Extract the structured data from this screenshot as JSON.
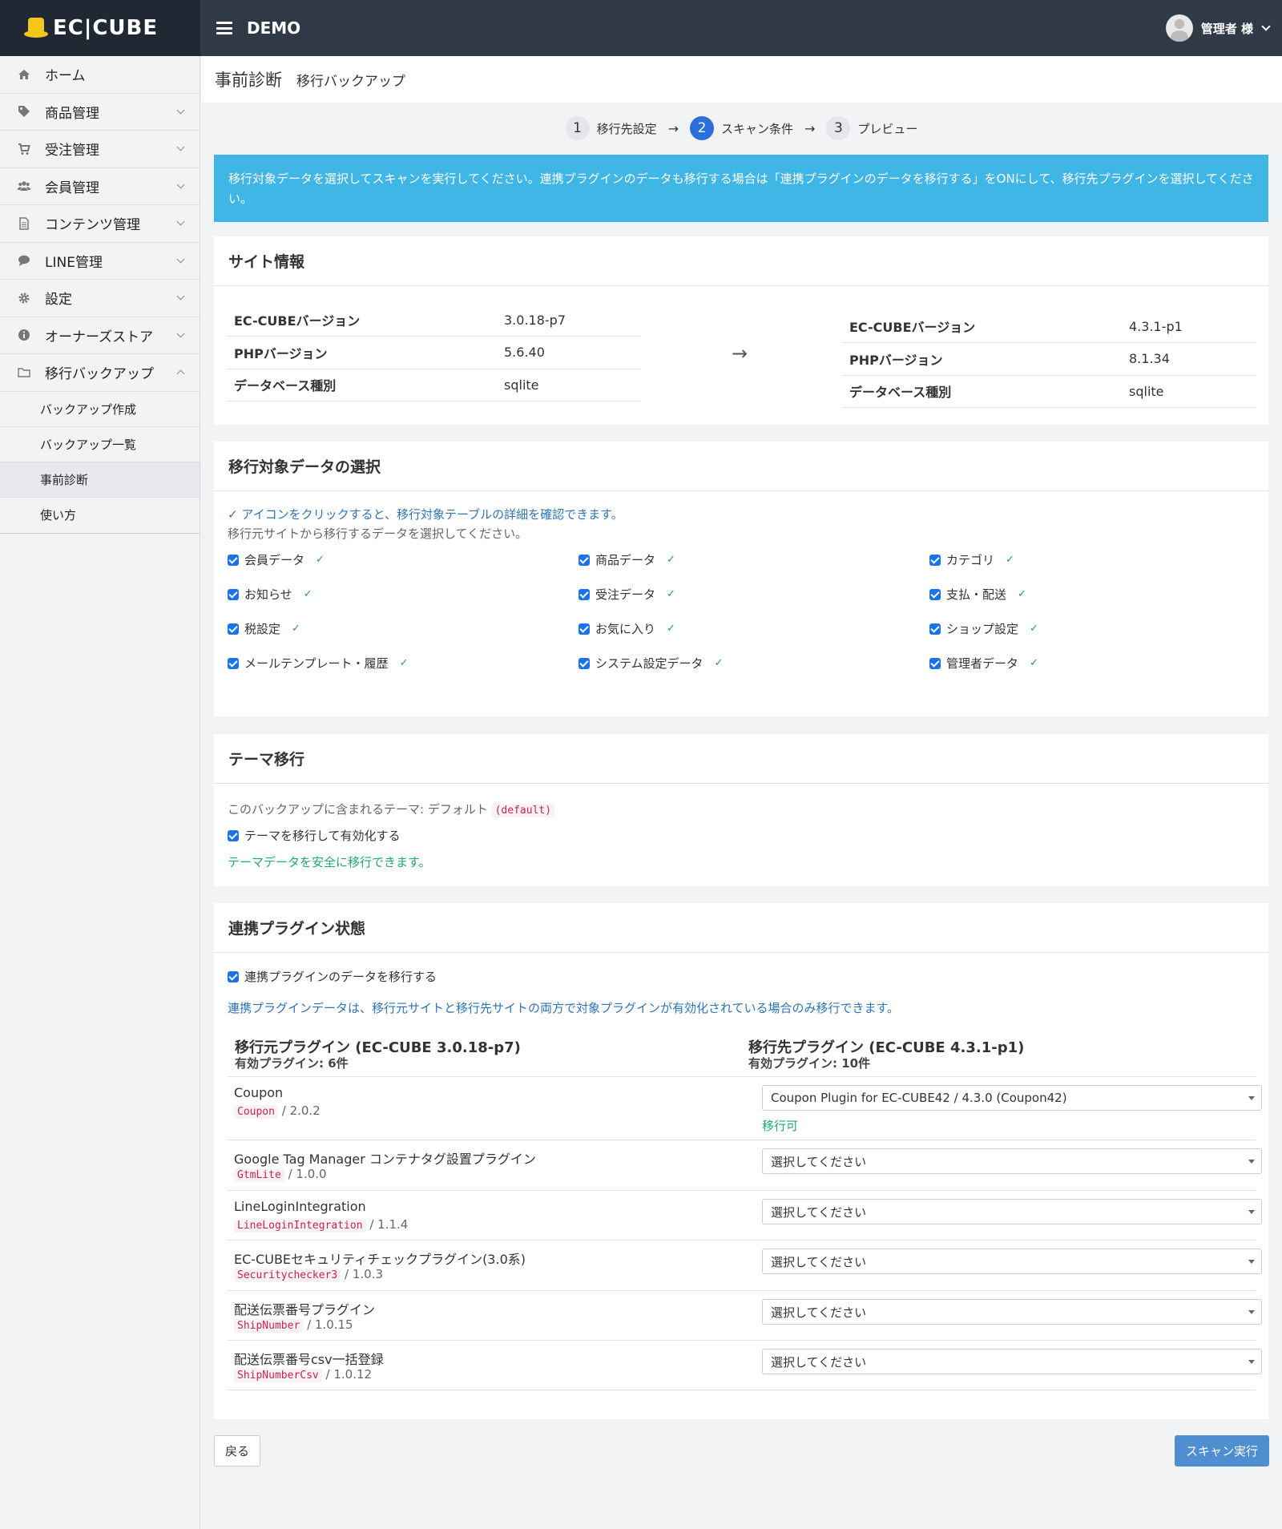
{
  "header": {
    "logo": "EC|CUBE",
    "shop_name": "DEMO",
    "user_label": "管理者 様"
  },
  "sidebar": {
    "items": [
      {
        "label": "ホーム",
        "icon": "home-icon"
      },
      {
        "label": "商品管理",
        "icon": "tag-icon"
      },
      {
        "label": "受注管理",
        "icon": "cart-icon"
      },
      {
        "label": "会員管理",
        "icon": "users-icon"
      },
      {
        "label": "コンテンツ管理",
        "icon": "file-icon"
      },
      {
        "label": "LINE管理",
        "icon": "chat-icon"
      },
      {
        "label": "設定",
        "icon": "gear-icon"
      },
      {
        "label": "オーナーズストア",
        "icon": "info-icon"
      },
      {
        "label": "移行バックアップ",
        "icon": "folder-icon"
      }
    ],
    "sub_items": [
      {
        "label": "バックアップ作成"
      },
      {
        "label": "バックアップ一覧"
      },
      {
        "label": "事前診断"
      },
      {
        "label": "使い方"
      }
    ]
  },
  "page": {
    "title": "事前診断",
    "subtitle": "移行バックアップ"
  },
  "steps": [
    {
      "num": "1",
      "label": "移行先設定"
    },
    {
      "num": "2",
      "label": "スキャン条件"
    },
    {
      "num": "3",
      "label": "プレビュー"
    }
  ],
  "step_arrow": "→",
  "alert": "移行対象データを選択してスキャンを実行してください。連携プラグインのデータも移行する場合は「連携プラグインのデータを移行する」をONにして、移行先プラグインを選択してください。",
  "site_info": {
    "title": "サイト情報",
    "source": [
      {
        "key": "EC-CUBEバージョン",
        "value": "3.0.18-p7"
      },
      {
        "key": "PHPバージョン",
        "value": "5.6.40"
      },
      {
        "key": "データベース種別",
        "value": "sqlite"
      }
    ],
    "arrow": "→",
    "target": [
      {
        "key": "EC-CUBEバージョン",
        "value": "4.3.1-p1"
      },
      {
        "key": "PHPバージョン",
        "value": "8.1.34"
      },
      {
        "key": "データベース種別",
        "value": "sqlite"
      }
    ]
  },
  "data_select": {
    "title": "移行対象データの選択",
    "hint": "✓ アイコンをクリックすると、移行対象テーブルの詳細を確認できます。",
    "desc": "移行元サイトから移行するデータを選択してください。",
    "tick": "✓",
    "items": [
      {
        "label": "会員データ",
        "checked": true
      },
      {
        "label": "商品データ",
        "checked": true
      },
      {
        "label": "カテゴリ",
        "checked": true
      },
      {
        "label": "お知らせ",
        "checked": true
      },
      {
        "label": "受注データ",
        "checked": true
      },
      {
        "label": "支払・配送",
        "checked": true
      },
      {
        "label": "税設定",
        "checked": true
      },
      {
        "label": "お気に入り",
        "checked": true
      },
      {
        "label": "ショップ設定",
        "checked": true
      },
      {
        "label": "メールテンプレート・履歴",
        "checked": true
      },
      {
        "label": "システム設定データ",
        "checked": true
      },
      {
        "label": "管理者データ",
        "checked": true
      }
    ]
  },
  "theme": {
    "title": "テーマ移行",
    "included_prefix": "このバックアップに含まれるテーマ: デフォルト",
    "included_code": "(default)",
    "checkbox_label": "テーマを移行して有効化する",
    "note": "テーマデータを安全に移行できます。"
  },
  "plugins": {
    "title": "連携プラグイン状態",
    "checkbox_label": "連携プラグインのデータを移行する",
    "note": "連携プラグインデータは、移行元サイトと移行先サイトの両方で対象プラグインが有効化されている場合のみ移行できます。",
    "source_head": "移行元プラグイン (EC-CUBE 3.0.18-p7)",
    "source_count": "有効プラグイン: 6件",
    "target_head": "移行先プラグイン (EC-CUBE 4.3.1-p1)",
    "target_count": "有効プラグイン: 10件",
    "rows": [
      {
        "name": "Coupon",
        "code": "Coupon",
        "version": "/ 2.0.2",
        "select": "Coupon Plugin for EC-CUBE42 / 4.3.0 (Coupon42)",
        "status": "移行可"
      },
      {
        "name": "Google Tag Manager コンテナタグ設置プラグイン",
        "code": "GtmLite",
        "version": "/ 1.0.0",
        "select": "選択してください"
      },
      {
        "name": "LineLoginIntegration",
        "code": "LineLoginIntegration",
        "version": "/ 1.1.4",
        "select": "選択してください"
      },
      {
        "name": "EC-CUBEセキュリティチェックプラグイン(3.0系)",
        "code": "Securitychecker3",
        "version": "/ 1.0.3",
        "select": "選択してください"
      },
      {
        "name": "配送伝票番号プラグイン",
        "code": "ShipNumber",
        "version": "/ 1.0.15",
        "select": "選択してください"
      },
      {
        "name": "配送伝票番号csv一括登録",
        "code": "ShipNumberCsv",
        "version": "/ 1.0.12",
        "select": "選択してください"
      }
    ]
  },
  "buttons": {
    "back": "戻る",
    "scan": "スキャン実行"
  }
}
